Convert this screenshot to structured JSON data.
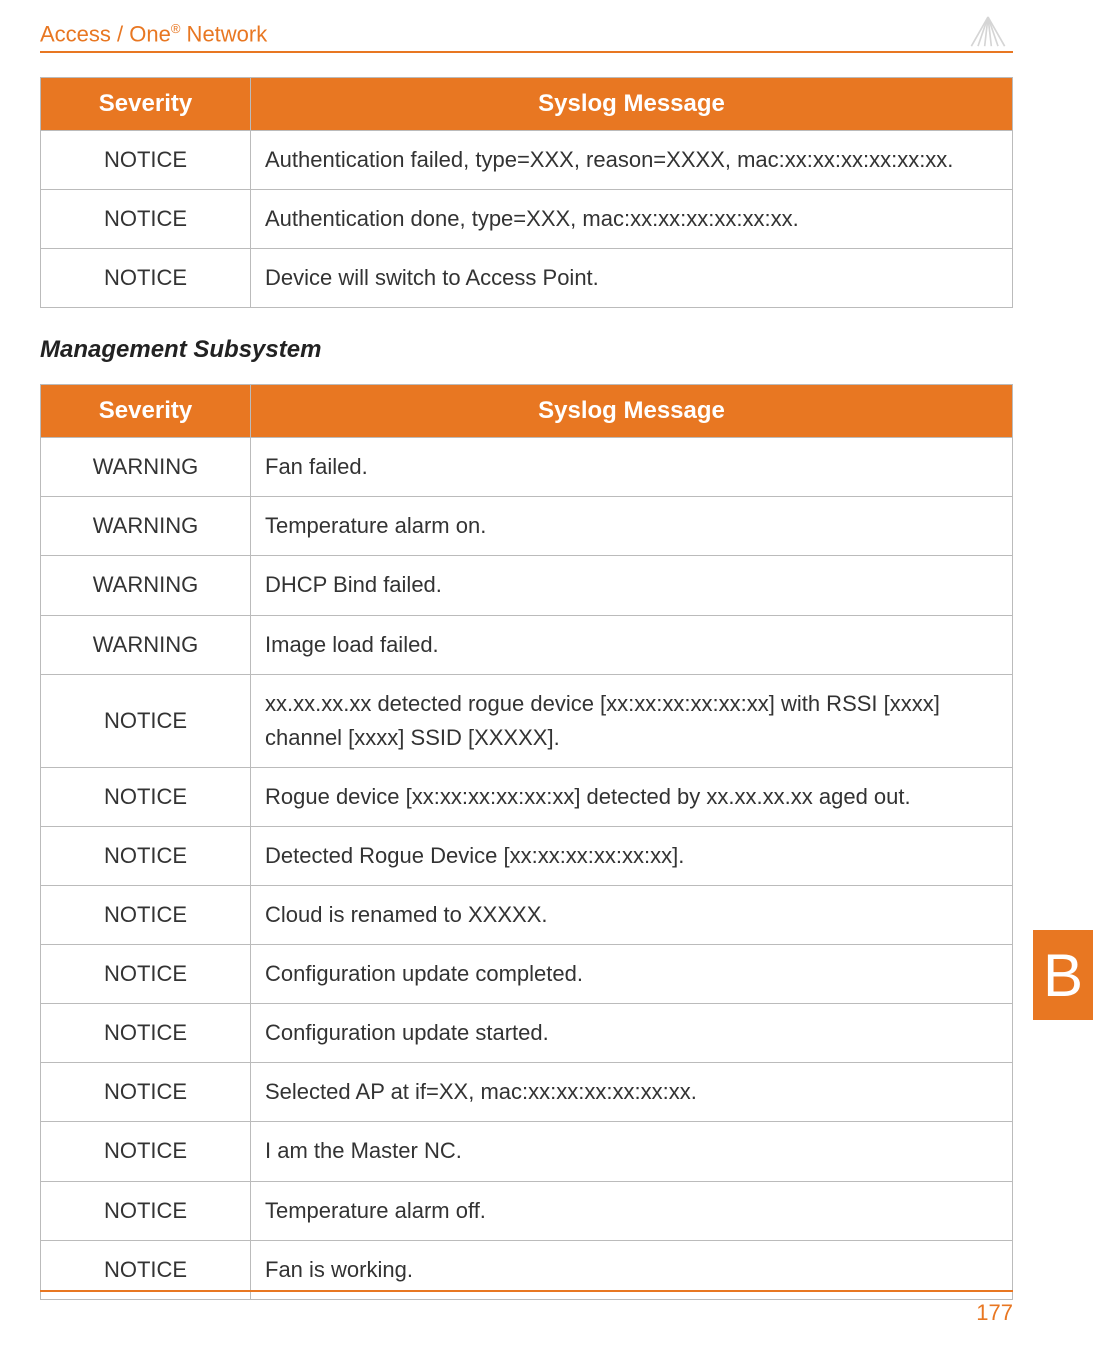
{
  "header": {
    "title_prefix": "Access / One",
    "title_suffix": " Network",
    "reg_mark": "®"
  },
  "table1": {
    "col_severity": "Severity",
    "col_message": "Syslog Message",
    "rows": [
      {
        "sev": "NOTICE",
        "msg": "Authentication failed, type=XXX, reason=XXXX, mac:xx:xx:xx:xx:xx:xx."
      },
      {
        "sev": "NOTICE",
        "msg": "Authentication done, type=XXX, mac:xx:xx:xx:xx:xx:xx."
      },
      {
        "sev": "NOTICE",
        "msg": "Device will switch to Access Point."
      }
    ]
  },
  "section2_heading": "Management Subsystem",
  "table2": {
    "col_severity": "Severity",
    "col_message": "Syslog Message",
    "rows": [
      {
        "sev": "WARNING",
        "msg": "Fan failed."
      },
      {
        "sev": "WARNING",
        "msg": "Temperature alarm on."
      },
      {
        "sev": "WARNING",
        "msg": "DHCP Bind failed."
      },
      {
        "sev": "WARNING",
        "msg": "Image load failed."
      },
      {
        "sev": "NOTICE",
        "msg": "xx.xx.xx.xx detected rogue device [xx:xx:xx:xx:xx:xx] with RSSI [xxxx] channel [xxxx] SSID [XXXXX]."
      },
      {
        "sev": "NOTICE",
        "msg": "Rogue device [xx:xx:xx:xx:xx:xx] detected by xx.xx.xx.xx aged out."
      },
      {
        "sev": "NOTICE",
        "msg": "Detected Rogue Device [xx:xx:xx:xx:xx:xx]."
      },
      {
        "sev": "NOTICE",
        "msg": "Cloud is renamed to XXXXX."
      },
      {
        "sev": "NOTICE",
        "msg": "Configuration update completed."
      },
      {
        "sev": "NOTICE",
        "msg": "Configuration update started."
      },
      {
        "sev": "NOTICE",
        "msg": "Selected AP at if=XX, mac:xx:xx:xx:xx:xx:xx."
      },
      {
        "sev": "NOTICE",
        "msg": "I am the Master NC."
      },
      {
        "sev": "NOTICE",
        "msg": "Temperature alarm off."
      },
      {
        "sev": "NOTICE",
        "msg": "Fan is working."
      }
    ]
  },
  "side_tab": "B",
  "page_number": "177"
}
